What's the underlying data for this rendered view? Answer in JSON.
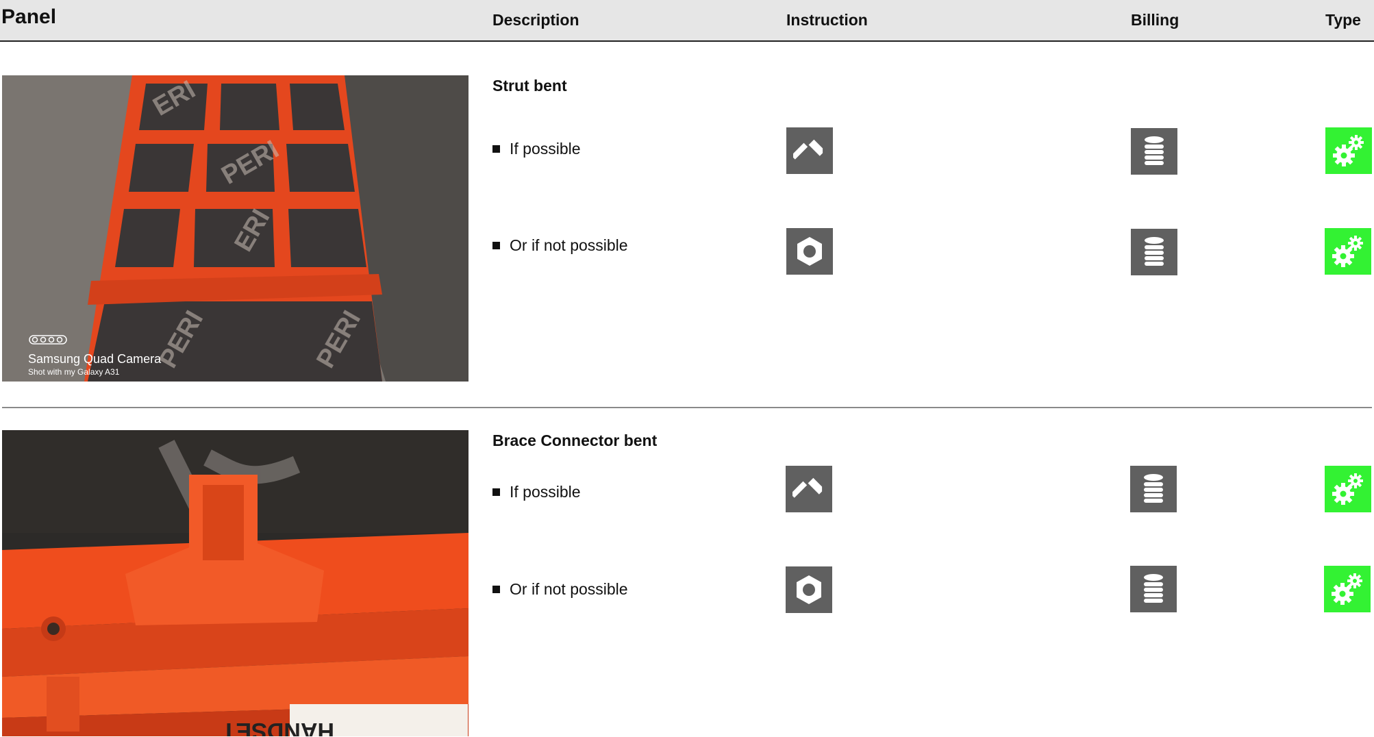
{
  "header": {
    "panel": "Panel",
    "description": "Description",
    "instruction": "Instruction",
    "billing": "Billing",
    "type": "Type"
  },
  "rows": [
    {
      "title": "Strut bent",
      "photo_caption": "Samsung Quad Camera",
      "photo_subcaption": "Shot with my Galaxy A31",
      "options": [
        {
          "text": "If possible",
          "instruction_icon": "hammer-icon",
          "billing_icon": "coin-stack-icon",
          "type_icon": "gears-icon"
        },
        {
          "text": "Or if not possible",
          "instruction_icon": "hex-nut-icon",
          "billing_icon": "coin-stack-icon",
          "type_icon": "gears-icon"
        }
      ]
    },
    {
      "title": "Brace Connector bent",
      "photo_text": "HANDSET",
      "options": [
        {
          "text": "If possible",
          "instruction_icon": "hammer-icon",
          "billing_icon": "coin-stack-icon",
          "type_icon": "gears-icon"
        },
        {
          "text": "Or if not possible",
          "instruction_icon": "hex-nut-icon",
          "billing_icon": "coin-stack-icon",
          "type_icon": "gears-icon"
        }
      ]
    }
  ],
  "colors": {
    "header_bg": "#e6e6e6",
    "icon_grey": "#606060",
    "type_green": "#33f233",
    "panel_orange": "#f04a1e"
  }
}
